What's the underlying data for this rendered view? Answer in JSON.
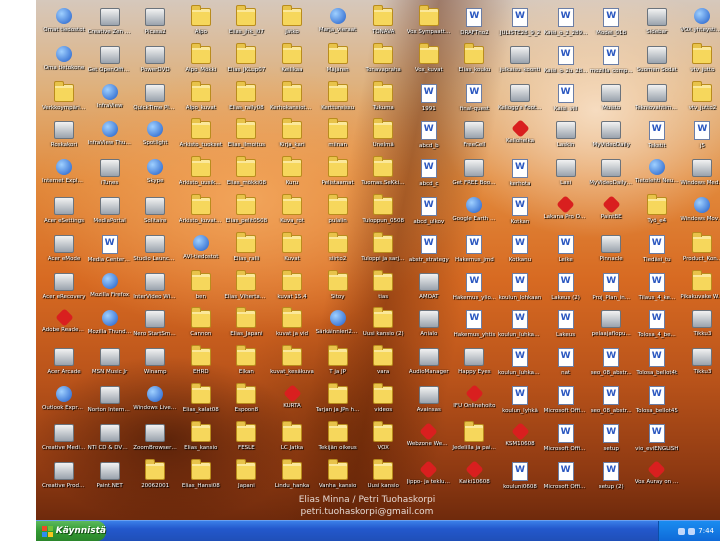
{
  "columns": [
    [
      "Omat tiedostot",
      "Oma tietokone",
      "Verkkoympäristö",
      "Roskakori",
      "Internet Explorer",
      "Acer eSettings",
      "Acer eMode",
      "Acer eRecovery",
      "Adobe Reader 7.0",
      "Acer Arcade",
      "Outlook Express",
      "Creative MediaSou...",
      "Creative Product Registration"
    ],
    [
      "Creative Zen Nano Plus Me...",
      "Get OpenOffice.org",
      "InfraView",
      "InfraView Thumbnails",
      "iTunes",
      "MediaPortal",
      "Media Center Setup",
      "Mozilla Firefox",
      "Mozilla Thunderbird",
      "MSN Music Jr",
      "Norton Internet Security",
      "NTI CD & DVD-Maker 7",
      "Paint.NET"
    ],
    [
      "Picasa2",
      "PowerDVD",
      "QuickTime Player",
      "Spotlight",
      "Skype",
      "Solitaire",
      "Studio Launcher",
      "InterVideo WinDVD",
      "Nero StartSmart",
      "Winamp",
      "Windows Live Messenger",
      "ZoomBrowser EX",
      "20062001"
    ],
    [
      "Alpo",
      "Alpo_Mökki",
      "Alpo_kuvat",
      "Arkisto_tuokset",
      "Arkisto_uusikset2",
      "Arkisto_kuvat_stn",
      "AVI-tiedostot",
      "ben",
      "Cannon",
      "EHRD",
      "Elias_kalat08",
      "Elias_kansio",
      "Elias_Hansi08"
    ],
    [
      "Elias_jhk_i07",
      "Elias_JKLup07",
      "Elias_rally08",
      "Elias_ilmoitus",
      "Elias_mökki08",
      "Elias_pelit0508",
      "Elias_ralli",
      "Elias_Vihertaakso",
      "Elias_Japani",
      "Elkan",
      "Espoon8",
      "FESLE",
      "Japani"
    ],
    [
      "Jatko",
      "Keilikaa",
      "Kerhokansiota07",
      "Kirja_kari",
      "Kuru",
      "Kuva_rot",
      "Kuvat",
      "kuvat 15.4",
      "kuvat ja vid",
      "kuvat_kesäkuva",
      "KURTA",
      "LC Jatka",
      "Lindu_hanka"
    ],
    [
      "Marja_vieraat",
      "Mäjären",
      "Kerttureissu",
      "miinan",
      "Pelistaamat",
      "pulalin",
      "siirto2",
      "Sitoy",
      "Särkäinnieri2008",
      "T ja JP",
      "Tarjan ja JPn häät",
      "Tekijän oikeus",
      "Vanha_kansio"
    ],
    [
      "TONAVA",
      "Tonavapraha",
      "Tukuma",
      "Unelmä",
      "Tuomas.SeKki07",
      "Tuloppun_0508",
      "Tuloppi ja sarja moitti",
      "tias",
      "Uusi kansio (2)",
      "vara",
      "videos",
      "VOX",
      "Uusi kansio"
    ],
    [
      "Vox Sympaatti07",
      "Vox_kuvat",
      "1991",
      "abcd_b",
      "abcd_c",
      "abcd_ulkov",
      "abstr_strategy",
      "AMOAT",
      "Anialo",
      "AudioManager",
      "Avainsas",
      "Webzone Website Builder",
      "Jippo- ja tekluehdo"
    ],
    [
      "DRAFTno2",
      "Elias_kouku",
      "final-quest",
      "FreeCell",
      "Get FREE Bookset",
      "Google Earth (device)",
      "Hakemus_jmd",
      "Hakemus_ylio...",
      "Hakemus_yhtis",
      "Happy Eyes",
      "IFU Onlinehoito",
      "Jedelilla ja paivamvessi",
      "Kaiki10608"
    ],
    [
      "JULISTE28_9_2",
      "julkaisu_koonti",
      "Kellogg's Football Tigers",
      "Kellohelka",
      "kerhota",
      "Kotkan",
      "Kotkanu",
      "koulun_lohkaan",
      "koulun_luhkaan 2",
      "koulun_luhkaan 3",
      "koulun_lyhkä",
      "KSM10608",
      "kouluni0608"
    ],
    [
      "Kaisi_o_2_28908",
      "Kaisi_o_2u_28...",
      "Kaisi_vill",
      "Laskin",
      "Lasi",
      "Lakana Pro Office Web 2...",
      "Leike",
      "Lakeus (2)",
      "Lakeus",
      "nat",
      "Microsoft Office Excel 2003",
      "Microsoft Office PowerPoint 2003",
      "Microsoft Office Word 2003"
    ],
    [
      "Model_01B",
      "mozilla_comp...",
      "Muisto",
      "MyVideoDaily",
      "MyVideoDaily Video",
      "PaintBE",
      "Pinnacle",
      "Proj_Plan_in...",
      "pelaajaflopu...",
      "seo_08_abstr...",
      "seo_08_abstr...",
      "setup",
      "setup (2)"
    ],
    [
      "Sidebar",
      "Suomen Sodat",
      "Tekniovahtime...",
      "Tekstit",
      "Tietolehti Neulasaduu",
      "Työ_e4",
      "Tiedäsi_tu",
      "Tilaus_4_ke...",
      "Tolosa_4_be...",
      "Tolosa_bellot4t",
      "Tolosa_bellot45",
      "vio_eviENGLISH",
      "Vox Auray on tehnyt lukuki..."
    ],
    [
      "VOX yhteystiedot",
      "vtv_jutto",
      "vtv_jutto2",
      "j5",
      "Windows Media Player",
      "Windows Movie Maker",
      "Product_Kon...",
      "Pikakuvake WahvMAC",
      "Tikku3",
      "Tikku3",
      "",
      "",
      ""
    ]
  ],
  "taskbar": {
    "start_label": "Käynnistä",
    "clock": "7:44"
  },
  "watermark": {
    "line1": "Elias Minna / Petri Tuohaskorpi",
    "line2": "petri.tuohaskorpi@gmail.com"
  },
  "colors": {
    "taskbar": "#2358cc",
    "start": "#339a33",
    "folder": "#f6d75c"
  }
}
